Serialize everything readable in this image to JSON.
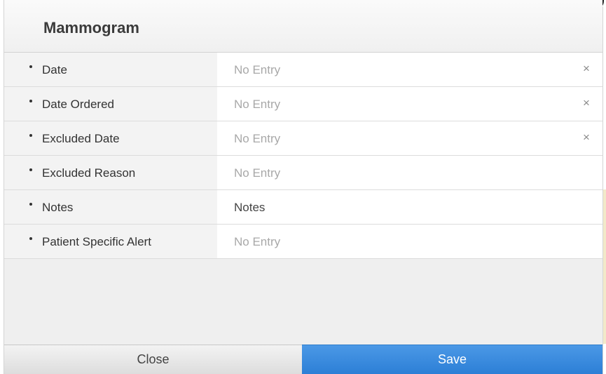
{
  "modal": {
    "title": "Mammogram",
    "fields": [
      {
        "label": "Date",
        "value": "No Entry",
        "clearable": true
      },
      {
        "label": "Date Ordered",
        "value": "No Entry",
        "clearable": true
      },
      {
        "label": "Excluded Date",
        "value": "No Entry",
        "clearable": true
      },
      {
        "label": "Excluded Reason",
        "value": "No Entry",
        "clearable": false
      },
      {
        "label": "Notes",
        "value": "Notes",
        "clearable": false
      },
      {
        "label": "Patient Specific Alert",
        "value": "No Entry",
        "clearable": false
      }
    ],
    "clear_glyph": "×",
    "footer": {
      "close_label": "Close",
      "save_label": "Save"
    }
  },
  "colors": {
    "save_blue": "#3a8ae0",
    "placeholder_gray": "#a8a8a8",
    "label_dark": "#333333"
  }
}
